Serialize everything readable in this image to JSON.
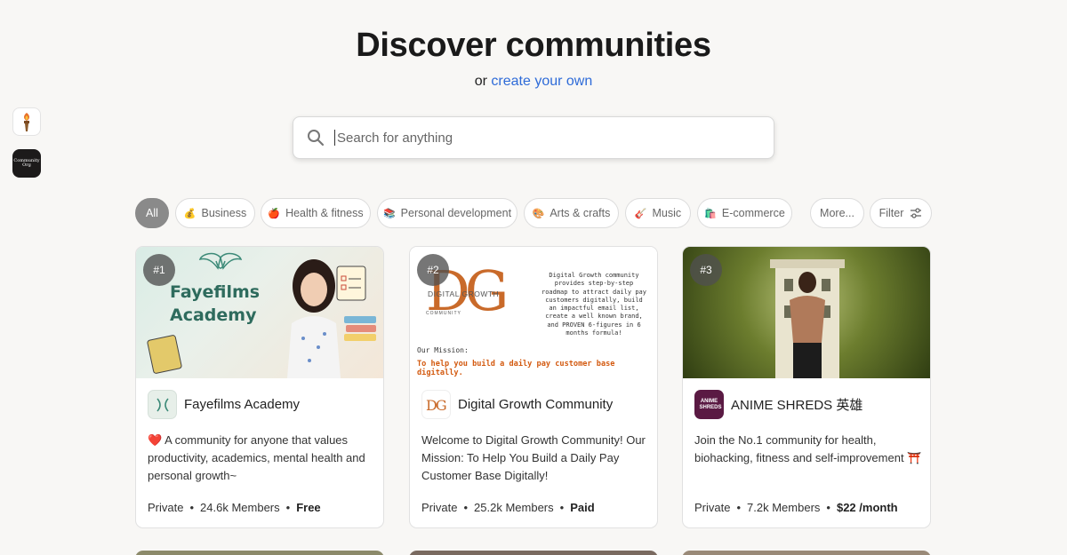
{
  "header": {
    "title": "Discover communities",
    "subtitle_prefix": "or",
    "subtitle_link": "create your own"
  },
  "search": {
    "placeholder": "Search for anything",
    "value": ""
  },
  "rail": [
    {
      "name": "torch-community",
      "icon": "torch-icon"
    },
    {
      "name": "community-org",
      "icon": "cc-logo",
      "label": "Community Org"
    }
  ],
  "chips": [
    {
      "label": "All",
      "emoji": "",
      "active": true
    },
    {
      "label": "Business",
      "emoji": "💰"
    },
    {
      "label": "Health & fitness",
      "emoji": "🍎"
    },
    {
      "label": "Personal development",
      "emoji": "📚"
    },
    {
      "label": "Arts & crafts",
      "emoji": "🎨"
    },
    {
      "label": "Music",
      "emoji": "🎸"
    },
    {
      "label": "E-commerce",
      "emoji": "🛍️"
    },
    {
      "label": "More...",
      "emoji": ""
    },
    {
      "label": "Filter",
      "emoji": ""
    }
  ],
  "cards": [
    {
      "rank": "#1",
      "name": "Fayefilms Academy",
      "description": "❤️ A community for anyone that values productivity, academics, mental health and personal growth~",
      "privacy": "Private",
      "members": "24.6k Members",
      "price": "Free",
      "image_title_line1": "Fayefilms",
      "image_title_line2": "Academy"
    },
    {
      "rank": "#2",
      "name": "Digital Growth Community",
      "description": "Welcome to Digital Growth Community! Our Mission: To Help You Build a Daily Pay Customer Base Digitally!",
      "privacy": "Private",
      "members": "25.2k Members",
      "price": "Paid",
      "image_logo": "DG",
      "image_logo_label": "DIGITAL GROWTH",
      "image_logo_sub": "COMMUNITY",
      "image_blurb": "Digital Growth community provides step-by-step roadmap to attract daily pay customers digitally, build an impactful email list, create a well known brand, and PROVEN 6-figures in 6 months formula!",
      "image_mission_label": "Our Mission:",
      "image_mission": "To help you build a daily pay customer base digitally."
    },
    {
      "rank": "#3",
      "name": "ANIME SHREDS 英雄",
      "description": "Join the No.1 community for health, biohacking, fitness and self-improvement ⛩️",
      "privacy": "Private",
      "members": "7.2k Members",
      "price": "$22 /month",
      "logo_text": "ANIME SHREDS"
    }
  ],
  "colors": {
    "link": "#2e6bd8",
    "active_chip": "#8a8a8a",
    "dg_orange": "#c96a2a",
    "anime_purple": "#5a1a43"
  }
}
